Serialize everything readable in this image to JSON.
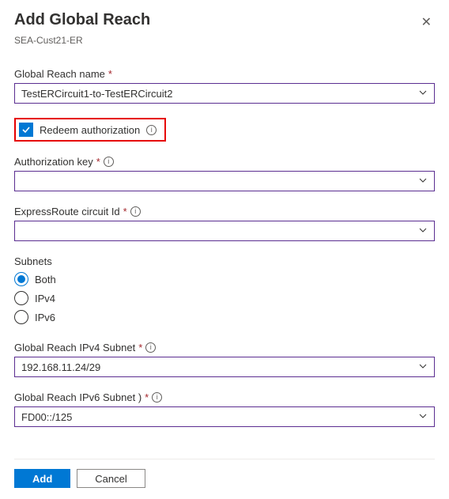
{
  "header": {
    "title": "Add Global Reach",
    "subtitle": "SEA-Cust21-ER"
  },
  "fields": {
    "name": {
      "label": "Global Reach name",
      "value": "TestERCircuit1-to-TestERCircuit2"
    },
    "redeem": {
      "label": "Redeem authorization"
    },
    "authKey": {
      "label": "Authorization key",
      "value": ""
    },
    "circuitId": {
      "label": "ExpressRoute circuit Id",
      "value": ""
    },
    "subnets": {
      "label": "Subnets",
      "options": {
        "both": "Both",
        "ipv4": "IPv4",
        "ipv6": "IPv6"
      }
    },
    "ipv4Subnet": {
      "label": "Global Reach IPv4 Subnet",
      "value": "192.168.11.24/29"
    },
    "ipv6Subnet": {
      "label": "Global Reach IPv6 Subnet )",
      "value": "FD00::/125"
    }
  },
  "footer": {
    "add": "Add",
    "cancel": "Cancel"
  }
}
